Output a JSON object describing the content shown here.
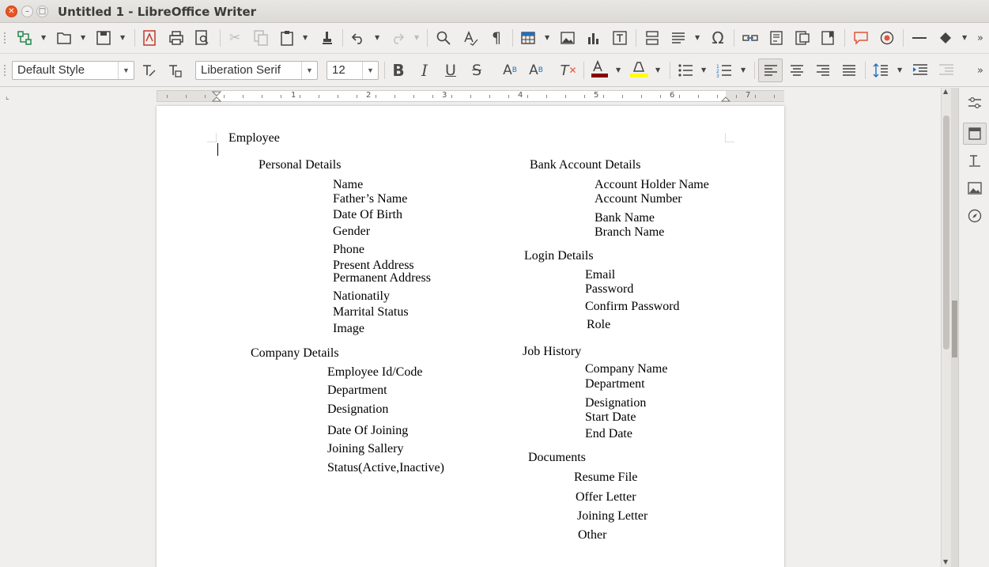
{
  "window": {
    "title": "Untitled 1 - LibreOffice Writer",
    "close_glyph": "✕",
    "minimize_glyph": "–",
    "maximize_glyph": "□"
  },
  "formatting": {
    "paragraph_style": "Default Style",
    "font_name": "Liberation Serif",
    "font_size": "12"
  },
  "colors": {
    "font_color": "#8b0000",
    "highlight_color": "#ffff00",
    "close_button": "#e95420"
  },
  "ruler": {
    "numbers": [
      "1",
      "2",
      "3",
      "4",
      "5",
      "6",
      "7"
    ]
  },
  "document": {
    "title": "Employee",
    "sections": {
      "personal": {
        "heading": "Personal Details",
        "items": [
          "Name",
          "Father’s Name",
          "Date Of Birth",
          "Gender",
          "Phone",
          "Present Address",
          "Permanent Address",
          "Nationatily",
          "Marrital Status",
          "Image"
        ]
      },
      "company": {
        "heading": "Company Details",
        "items": [
          "Employee Id/Code",
          "Department",
          "Designation",
          "Date Of Joining",
          "Joining Sallery",
          "Status(Active,Inactive)"
        ]
      },
      "bank": {
        "heading": "Bank Account Details",
        "items": [
          "Account Holder Name",
          "Account Number",
          "Bank Name",
          "Branch Name"
        ]
      },
      "login": {
        "heading": "Login Details",
        "items": [
          "Email",
          "Password",
          "Confirm Password",
          "Role"
        ]
      },
      "job": {
        "heading": "Job History",
        "items": [
          "Company Name",
          "Department",
          "Designation",
          "Start Date",
          "End Date"
        ]
      },
      "documents": {
        "heading": "Documents",
        "items": [
          "Resume File",
          "Offer Letter",
          "Joining Letter",
          "Other"
        ]
      }
    }
  },
  "icons": {
    "toolbar1": [
      "navigator-icon",
      "open-icon",
      "save-icon",
      "export-pdf-icon",
      "print-icon",
      "print-preview-icon",
      "cut-icon",
      "copy-icon",
      "paste-icon",
      "clone-format-icon",
      "undo-icon",
      "redo-icon",
      "find-replace-icon",
      "spelling-icon",
      "formatting-marks-icon",
      "insert-table-icon",
      "insert-image-icon",
      "insert-chart-icon",
      "insert-textbox-icon",
      "page-break-icon",
      "insert-field-icon",
      "special-character-icon",
      "hyperlink-icon",
      "footnote-icon",
      "endnote-icon",
      "bookmark-icon",
      "comment-icon",
      "track-changes-icon",
      "insert-line-icon",
      "basic-shapes-icon",
      "more-icon"
    ],
    "toolbar2": [
      "update-style-icon",
      "new-style-icon",
      "bold-icon",
      "italic-icon",
      "underline-icon",
      "strikethrough-icon",
      "superscript-icon",
      "subscript-icon",
      "clear-formatting-icon",
      "font-color-icon",
      "highlight-icon",
      "unordered-list-icon",
      "ordered-list-icon",
      "align-left-icon",
      "align-center-icon",
      "align-right-icon",
      "justify-icon",
      "line-spacing-icon",
      "increase-indent-icon",
      "decrease-indent-icon",
      "more-icon"
    ],
    "sidebar": [
      "properties-icon",
      "page-icon",
      "styles-icon",
      "gallery-icon",
      "navigator-sidebar-icon"
    ]
  }
}
